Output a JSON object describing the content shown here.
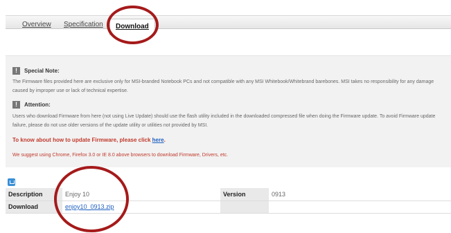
{
  "tabs": [
    {
      "label": "Overview"
    },
    {
      "label": "Specification"
    },
    {
      "label": "Download"
    }
  ],
  "notes": {
    "special_title": "Special Note:",
    "special_text": "The Firmware files provided here are exclusive only for MSI-branded Notebook PCs and not compatible with any MSI Whitebook/Whitebrand barebones. MSI takes no responsibility for any damage caused by improper use or lack of technical expertise.",
    "attention_title": "Attention:",
    "attention_text": "Users who download Firmware from here (not using Live Update) should use the flash utility included in the downloaded compressed file when doing the Firmware update. To avoid Firmware update failure, please do not use older versions of the update utility or utilities not provided by MSI.",
    "howto_text": "To know about how to update Firmware, please click ",
    "howto_link": "here",
    "howto_suffix": ".",
    "browser_text": "We suggest using Chrome, Firefox 3.0 or IE 8.0 above browsers to download Firmware, Drivers, etc.",
    "note_icon": "exclamation-icon"
  },
  "download_table": {
    "rows": [
      {
        "label": "Description",
        "value": "Enjoy 10",
        "label2": "Version",
        "value2": "0913"
      },
      {
        "label": "Download",
        "value": "enjoy10_0913.zip",
        "label2": "",
        "value2": ""
      }
    ],
    "icon": "download-icon"
  },
  "colors": {
    "accent_red": "#c0392b",
    "link_blue": "#1e5fbf",
    "annotation_circle": "#a51a1a"
  }
}
